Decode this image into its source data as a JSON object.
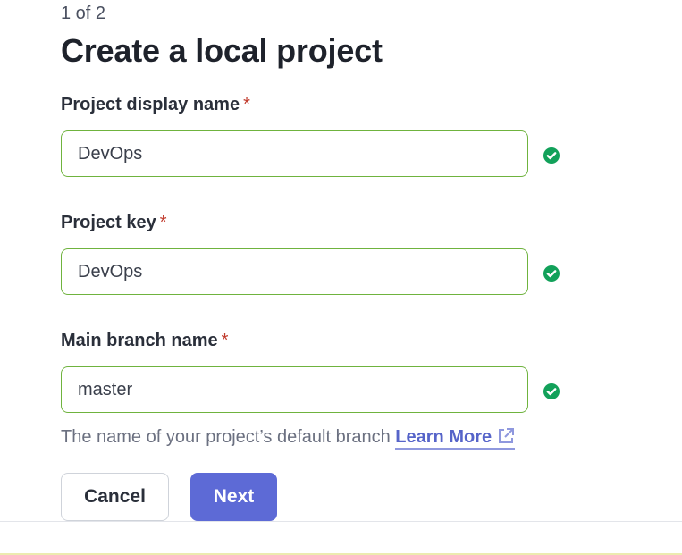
{
  "wizard": {
    "step_text": "1 of 2",
    "title": "Create a local project"
  },
  "fields": {
    "display_name": {
      "label": "Project display name",
      "required_mark": "*",
      "value": "DevOps"
    },
    "project_key": {
      "label": "Project key",
      "required_mark": "*",
      "value": "DevOps"
    },
    "main_branch": {
      "label": "Main branch name",
      "required_mark": "*",
      "value": "master",
      "help_text": "The name of your project’s default branch",
      "help_link": "Learn More"
    }
  },
  "buttons": {
    "cancel": "Cancel",
    "next": "Next"
  },
  "icons": {
    "valid": "check-circle-icon",
    "external": "external-link-icon"
  },
  "colors": {
    "primary": "#5d6ad6",
    "valid": "#12a15a",
    "input_border_valid": "#6fb33e",
    "required": "#c0392b",
    "link": "#5664c9"
  }
}
